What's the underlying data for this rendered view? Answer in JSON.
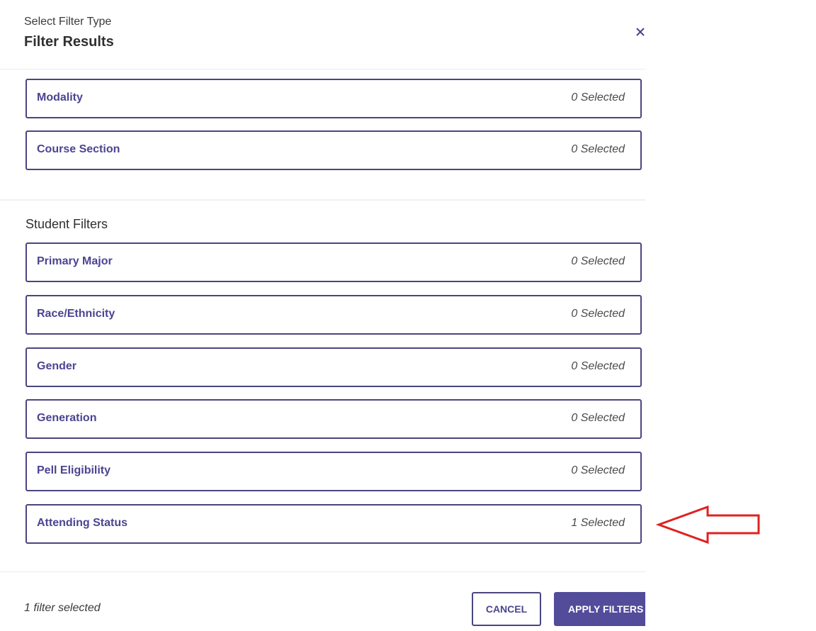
{
  "header": {
    "subtitle": "Select Filter Type",
    "title": "Filter Results",
    "close_icon": "close-icon"
  },
  "course_filters": [
    {
      "name": "Modality",
      "count": "0 Selected"
    },
    {
      "name": "Course Section",
      "count": "0 Selected"
    }
  ],
  "student_section": {
    "heading": "Student Filters",
    "filters": [
      {
        "name": "Primary Major",
        "count": "0 Selected"
      },
      {
        "name": "Race/Ethnicity",
        "count": "0 Selected"
      },
      {
        "name": "Gender",
        "count": "0 Selected"
      },
      {
        "name": "Generation",
        "count": "0 Selected"
      },
      {
        "name": "Pell Eligibility",
        "count": "0 Selected"
      },
      {
        "name": "Attending Status",
        "count": "1 Selected"
      }
    ]
  },
  "footer": {
    "status": "1 filter selected",
    "cancel_label": "CANCEL",
    "apply_label": "APPLY FILTERS"
  },
  "annotation": {
    "icon": "red-arrow-icon",
    "color": "#e02020"
  },
  "colors": {
    "accent": "#534c9a",
    "border": "#4a4580",
    "label": "#4b4491"
  }
}
